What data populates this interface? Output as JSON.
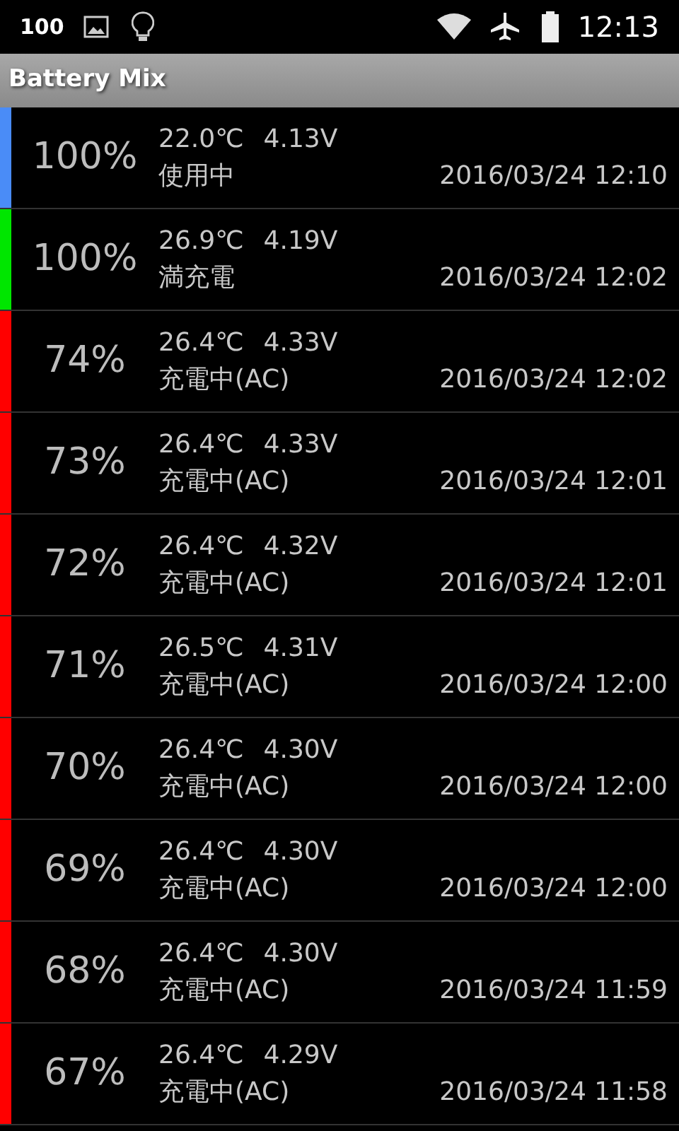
{
  "status_bar": {
    "battery_text": "100",
    "time": "12:13"
  },
  "title": "Battery Mix",
  "rows": [
    {
      "percent": "100%",
      "temp": "22.0℃",
      "voltage": "4.13V",
      "state": "使用中",
      "time": "2016/03/24 12:10",
      "color": "#4a8cf7"
    },
    {
      "percent": "100%",
      "temp": "26.9℃",
      "voltage": "4.19V",
      "state": "満充電",
      "time": "2016/03/24 12:02",
      "color": "#00e600"
    },
    {
      "percent": "74%",
      "temp": "26.4℃",
      "voltage": "4.33V",
      "state": "充電中(AC)",
      "time": "2016/03/24 12:02",
      "color": "#ff0000"
    },
    {
      "percent": "73%",
      "temp": "26.4℃",
      "voltage": "4.33V",
      "state": "充電中(AC)",
      "time": "2016/03/24 12:01",
      "color": "#ff0000"
    },
    {
      "percent": "72%",
      "temp": "26.4℃",
      "voltage": "4.32V",
      "state": "充電中(AC)",
      "time": "2016/03/24 12:01",
      "color": "#ff0000"
    },
    {
      "percent": "71%",
      "temp": "26.5℃",
      "voltage": "4.31V",
      "state": "充電中(AC)",
      "time": "2016/03/24 12:00",
      "color": "#ff0000"
    },
    {
      "percent": "70%",
      "temp": "26.4℃",
      "voltage": "4.30V",
      "state": "充電中(AC)",
      "time": "2016/03/24 12:00",
      "color": "#ff0000"
    },
    {
      "percent": "69%",
      "temp": "26.4℃",
      "voltage": "4.30V",
      "state": "充電中(AC)",
      "time": "2016/03/24 12:00",
      "color": "#ff0000"
    },
    {
      "percent": "68%",
      "temp": "26.4℃",
      "voltage": "4.30V",
      "state": "充電中(AC)",
      "time": "2016/03/24 11:59",
      "color": "#ff0000"
    },
    {
      "percent": "67%",
      "temp": "26.4℃",
      "voltage": "4.29V",
      "state": "充電中(AC)",
      "time": "2016/03/24 11:58",
      "color": "#ff0000"
    }
  ]
}
